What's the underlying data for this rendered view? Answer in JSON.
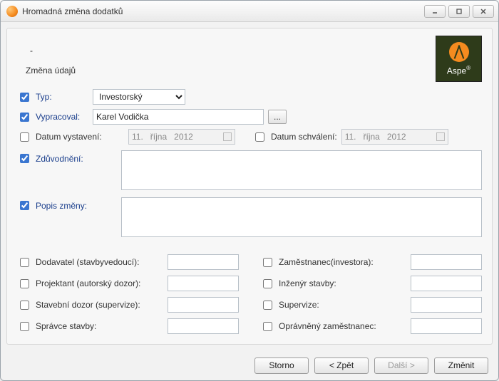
{
  "window": {
    "title": "Hromadná změna dodatků"
  },
  "header": {
    "dash": "-",
    "subtitle": "Změna údajů"
  },
  "logo": {
    "text": "Aspe"
  },
  "fields": {
    "typ": {
      "label": "Typ:",
      "checked": true,
      "select": {
        "value": "Investorský",
        "options": [
          "Investorský"
        ]
      }
    },
    "vypracoval": {
      "label": "Vypracoval:",
      "checked": true,
      "value": "Karel Vodička",
      "browse": "..."
    },
    "datum_vystaveni": {
      "label": "Datum vystavení:",
      "checked": false,
      "day": "11.",
      "month": "října",
      "year": "2012"
    },
    "datum_schvaleni": {
      "label": "Datum schválení:",
      "checked": false,
      "day": "11.",
      "month": "října",
      "year": "2012"
    },
    "zduvodneni": {
      "label": "Zdůvodnění:",
      "checked": true,
      "value": ""
    },
    "popis": {
      "label": "Popis změny:",
      "checked": true,
      "value": ""
    }
  },
  "roles": {
    "left": [
      {
        "label": "Dodavatel (stavbyvedoucí):",
        "checked": false,
        "value": ""
      },
      {
        "label": "Projektant (autorský dozor):",
        "checked": false,
        "value": ""
      },
      {
        "label": "Stavební dozor (supervize):",
        "checked": false,
        "value": ""
      },
      {
        "label": "Správce stavby:",
        "checked": false,
        "value": ""
      }
    ],
    "right": [
      {
        "label": "Zaměstnanec(investora):",
        "checked": false,
        "value": ""
      },
      {
        "label": "Inženýr stavby:",
        "checked": false,
        "value": ""
      },
      {
        "label": "Supervize:",
        "checked": false,
        "value": ""
      },
      {
        "label": "Oprávněný zaměstnanec:",
        "checked": false,
        "value": ""
      }
    ]
  },
  "buttons": {
    "storno": "Storno",
    "back": "< Zpět",
    "next": "Další >",
    "change": "Změnit"
  }
}
